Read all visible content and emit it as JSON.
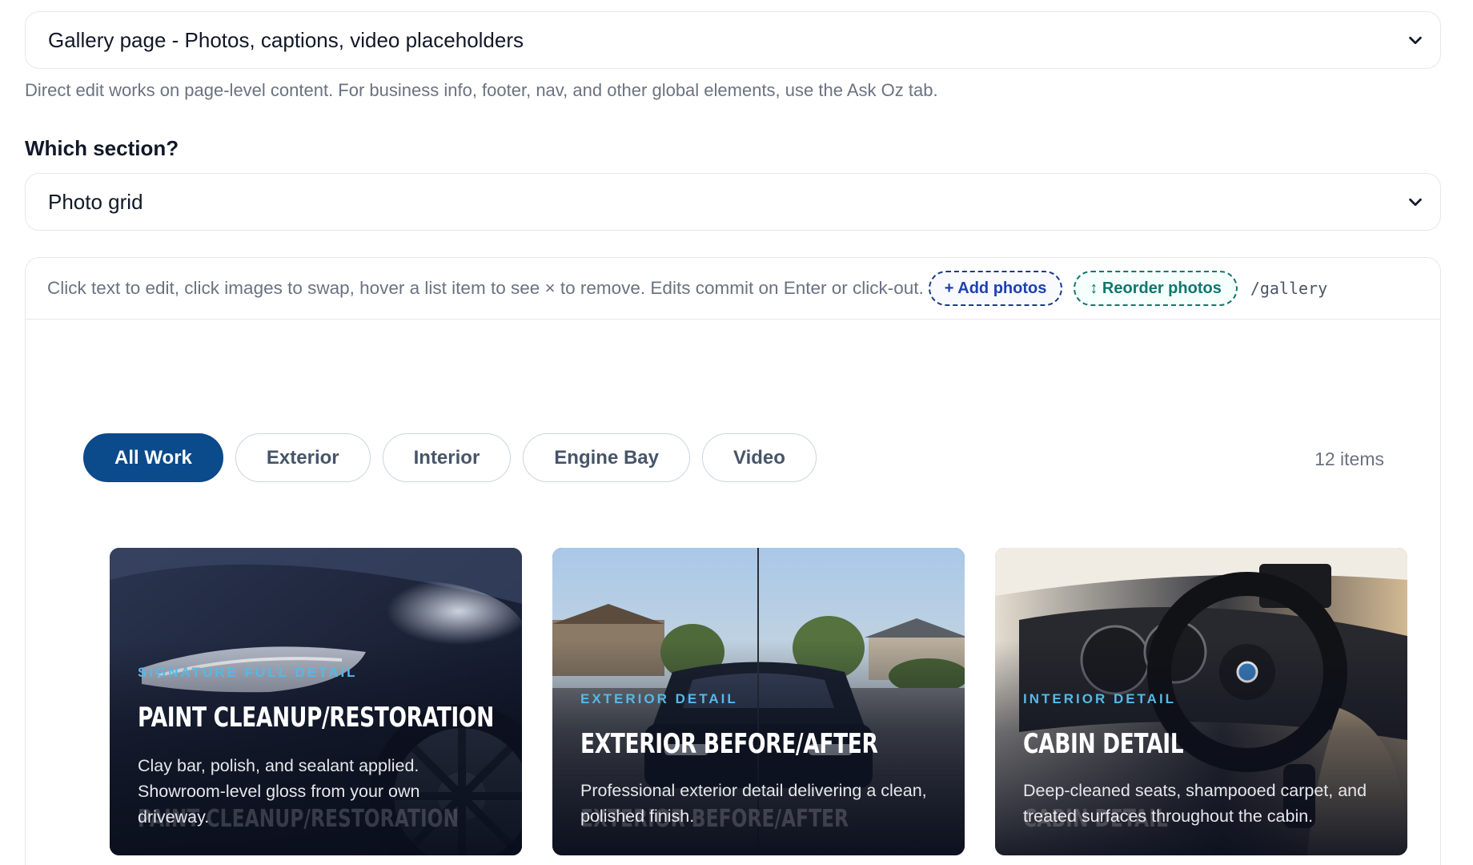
{
  "page_select": {
    "value": "Gallery page - Photos, captions, video placeholders"
  },
  "hint": "Direct edit works on page-level content. For business info, footer, nav, and other global elements, use the Ask Oz tab.",
  "section_label": "Which section?",
  "section_select": {
    "value": "Photo grid"
  },
  "toolbar": {
    "instructions": "Click text to edit, click images to swap, hover a list item to see × to remove. Edits commit on Enter or click-out.",
    "add_photos": "+ Add photos",
    "reorder_photos": "↕ Reorder photos",
    "route": "/gallery"
  },
  "filters": [
    "All Work",
    "Exterior",
    "Interior",
    "Engine Bay",
    "Video"
  ],
  "active_filter": "All Work",
  "item_count": "12 items",
  "cards": [
    {
      "tag": "SIGNATURE FULL DETAIL",
      "title": "PAINT CLEANUP/RESTORATION",
      "description": "Clay bar, polish, and sealant applied. Showroom-level gloss from your own driveway."
    },
    {
      "tag": "EXTERIOR DETAIL",
      "title": "EXTERIOR BEFORE/AFTER",
      "description": "Professional exterior detail delivering a clean, polished finish."
    },
    {
      "tag": "INTERIOR DETAIL",
      "title": "CABIN DETAIL",
      "description": "Deep-cleaned seats, shampooed carpet, and treated surfaces throughout the cabin."
    }
  ],
  "colors": {
    "active_chip": "#0b4a8b",
    "add_photos": "#1e40af",
    "reorder_photos": "#0f766e",
    "card_tag": "#56b8e6"
  }
}
